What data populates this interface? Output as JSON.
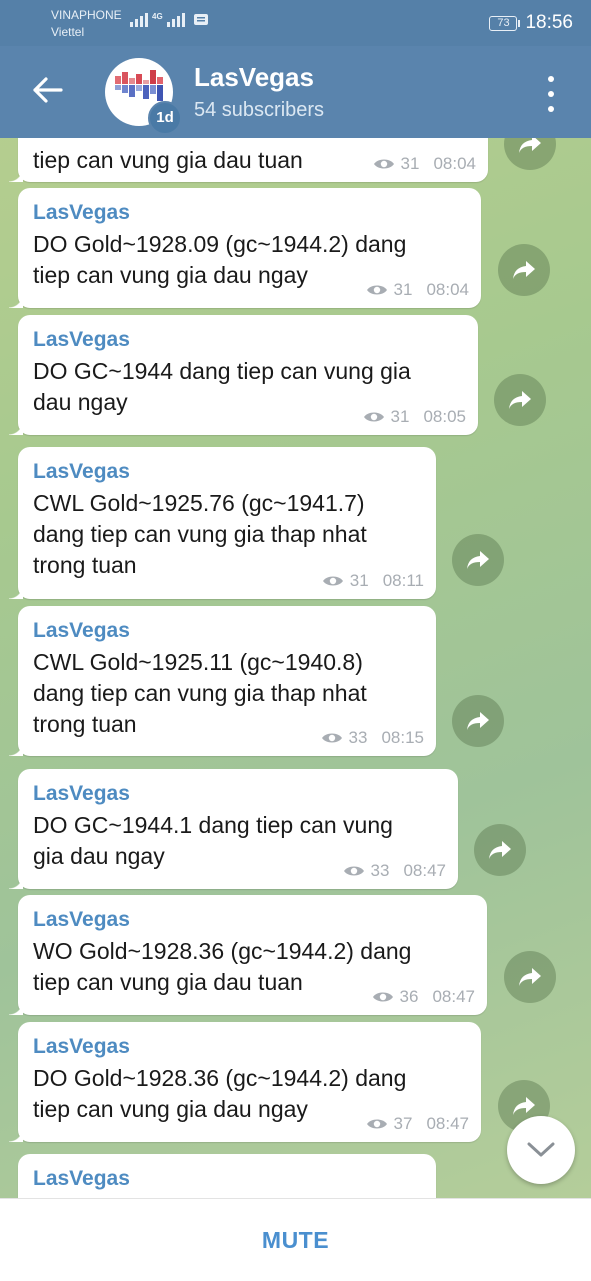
{
  "status": {
    "carrier1": "VINAPHONE",
    "carrier2": "Viettel",
    "network": "4G",
    "battery": "73",
    "time": "18:56"
  },
  "header": {
    "title": "LasVegas",
    "subtitle": "54 subscribers",
    "avatar_badge": "1d"
  },
  "messages": [
    {
      "sender": "",
      "lines": [
        "tiep can vung gia dau tuan"
      ],
      "views": "31",
      "time": "08:04"
    },
    {
      "sender": "LasVegas",
      "lines": [
        "DO Gold~1928.09 (gc~1944.2) dang",
        "tiep can vung gia dau ngay"
      ],
      "views": "31",
      "time": "08:04"
    },
    {
      "sender": "LasVegas",
      "lines": [
        "DO GC~1944 dang tiep can vung gia",
        "dau ngay"
      ],
      "views": "31",
      "time": "08:05"
    },
    {
      "sender": "LasVegas",
      "lines": [
        "CWL Gold~1925.76 (gc~1941.7)",
        "dang tiep can vung gia thap nhat",
        "trong tuan"
      ],
      "views": "31",
      "time": "08:11"
    },
    {
      "sender": "LasVegas",
      "lines": [
        "CWL Gold~1925.11 (gc~1940.8)",
        "dang tiep can vung gia thap nhat",
        "trong tuan"
      ],
      "views": "33",
      "time": "08:15"
    },
    {
      "sender": "LasVegas",
      "lines": [
        "DO GC~1944.1 dang tiep can vung",
        "gia dau ngay"
      ],
      "views": "33",
      "time": "08:47"
    },
    {
      "sender": "LasVegas",
      "lines": [
        "WO Gold~1928.36 (gc~1944.2) dang",
        "tiep can vung gia dau tuan"
      ],
      "views": "36",
      "time": "08:47"
    },
    {
      "sender": "LasVegas",
      "lines": [
        "DO Gold~1928.36 (gc~1944.2) dang",
        "tiep can vung gia dau ngay"
      ],
      "views": "37",
      "time": "08:47"
    },
    {
      "sender": "LasVegas",
      "lines": [],
      "views": "",
      "time": ""
    }
  ],
  "bottom": {
    "mute_label": "MUTE"
  },
  "icons": {
    "back": "arrow-left-icon",
    "menu": "more-vertical-icon",
    "share": "share-arrow-icon",
    "views": "eye-icon",
    "scroll": "chevron-down-icon"
  },
  "colors": {
    "header": "#5a84ad",
    "status_bar": "#5580a8",
    "sender": "#4e8bc1",
    "mute": "#4a8fcf"
  }
}
